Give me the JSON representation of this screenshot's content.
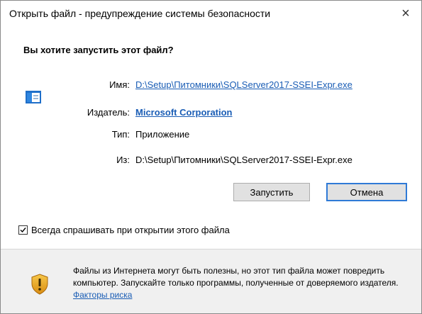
{
  "window": {
    "title": "Открыть файл - предупреждение системы безопасности",
    "close_glyph": "×"
  },
  "prompt": {
    "question": "Вы хотите запустить этот файл?"
  },
  "details": {
    "name_label": "Имя:",
    "name_value": "D:\\Setup\\Питомники\\SQLServer2017-SSEI-Expr.exe",
    "publisher_label": "Издатель:",
    "publisher_value": "Microsoft Corporation",
    "type_label": "Тип:",
    "type_value": "Приложение",
    "from_label": "Из:",
    "from_value": "D:\\Setup\\Питомники\\SQLServer2017-SSEI-Expr.exe"
  },
  "buttons": {
    "run_label": "Запустить",
    "cancel_label": "Отмена"
  },
  "checkbox": {
    "label": "Всегда спрашивать при открытии этого файла",
    "checked": true
  },
  "footer": {
    "warning_text_1": "Файлы из Интернета могут быть полезны, но этот тип файла может повредить компьютер. Запускайте только программы, полученные от доверяемого издателя. ",
    "risk_link": "Факторы риска"
  },
  "colors": {
    "link": "#1a5db5",
    "footer_bg": "#f0f0f0",
    "default_button_border": "#2f7ad6"
  },
  "icons": [
    "close-icon",
    "file-icon",
    "checkmark-icon",
    "shield-warning-icon"
  ]
}
